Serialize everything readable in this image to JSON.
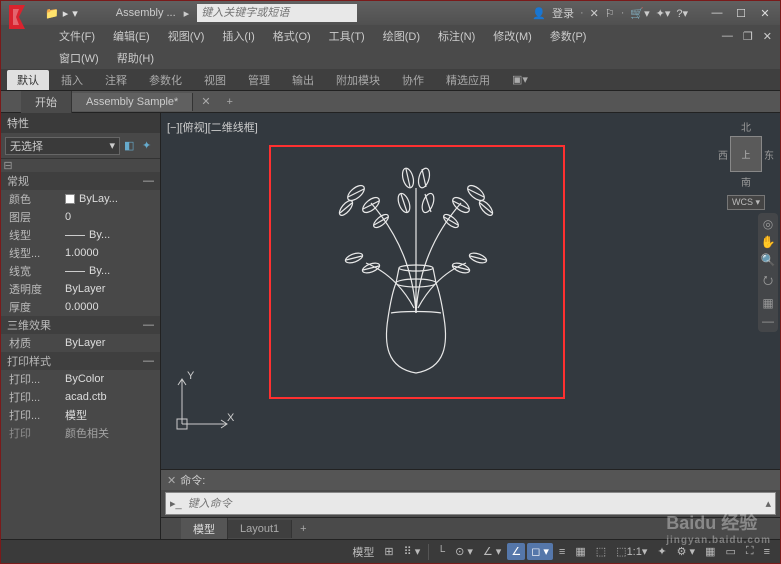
{
  "title": "Assembly ...",
  "search_placeholder": "键入关键字或短语",
  "login_label": "登录",
  "menubar": [
    "文件(F)",
    "编辑(E)",
    "视图(V)",
    "插入(I)",
    "格式(O)",
    "工具(T)",
    "绘图(D)",
    "标注(N)",
    "修改(M)",
    "参数(P)"
  ],
  "menubar2": [
    "窗口(W)",
    "帮助(H)"
  ],
  "ribbon_tabs": [
    "默认",
    "插入",
    "注释",
    "参数化",
    "视图",
    "管理",
    "输出",
    "附加模块",
    "协作",
    "精选应用"
  ],
  "doc_tabs": [
    "开始",
    "Assembly Sample*"
  ],
  "sidebar": {
    "title": "特性",
    "selector": "无选择",
    "groups": [
      {
        "name": "常规",
        "rows": [
          {
            "k": "颜色",
            "v": "ByLay...",
            "swatch": true
          },
          {
            "k": "图层",
            "v": "0"
          },
          {
            "k": "线型",
            "v": "By...",
            "line": true
          },
          {
            "k": "线型...",
            "v": "1.0000"
          },
          {
            "k": "线宽",
            "v": "By...",
            "line": true
          },
          {
            "k": "透明度",
            "v": "ByLayer"
          },
          {
            "k": "厚度",
            "v": "0.0000"
          }
        ]
      },
      {
        "name": "三维效果",
        "rows": [
          {
            "k": "材质",
            "v": "ByLayer"
          }
        ]
      },
      {
        "name": "打印样式",
        "rows": [
          {
            "k": "打印...",
            "v": "ByColor"
          },
          {
            "k": "打印...",
            "v": "acad.ctb"
          },
          {
            "k": "打印...",
            "v": "模型"
          },
          {
            "k": "打印",
            "v": "颜色相关"
          }
        ]
      }
    ]
  },
  "viewport_label": "[−][俯视][二维线框]",
  "compass": {
    "n": "北",
    "e": "东",
    "s": "南",
    "w": "西",
    "face": "上",
    "wcs": "WCS"
  },
  "axes": {
    "x": "X",
    "y": "Y"
  },
  "cmd": {
    "label": "命令:",
    "placeholder": "键入命令"
  },
  "layout_tabs": [
    "模型",
    "Layout1"
  ],
  "status": {
    "model": "模型",
    "scale": "1:1"
  },
  "watermark": {
    "brand": "Baidu 经验",
    "url": "jingyan.baidu.com"
  }
}
